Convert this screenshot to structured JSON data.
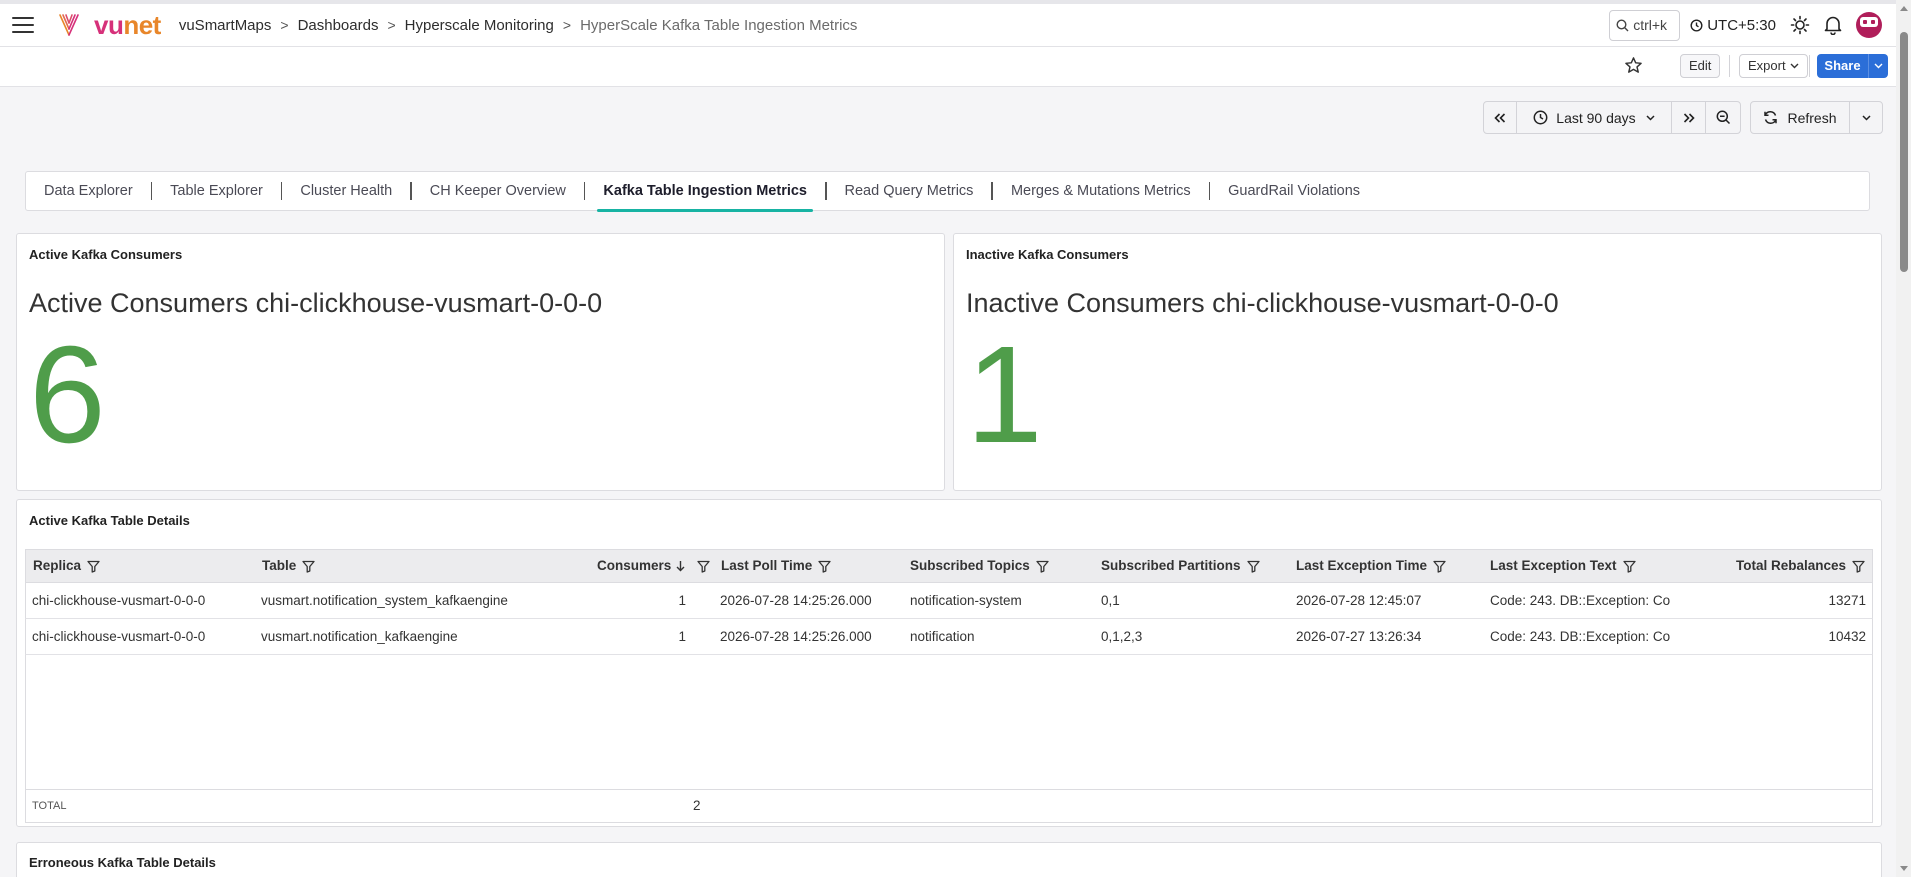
{
  "brand": {
    "logo_vu": "vu",
    "logo_net": "net",
    "colors": {
      "vu": "#d6317a",
      "net": "#e8862a",
      "accent": "#17b3a3",
      "value": "#4f9d4a",
      "primary": "#2b6ed8"
    }
  },
  "breadcrumb": [
    "vuSmartMaps",
    "Dashboards",
    "Hyperscale Monitoring",
    "HyperScale Kafka Table Ingestion Metrics"
  ],
  "header": {
    "search_shortcut": "ctrl+k",
    "timezone": "UTC+5:30"
  },
  "actions": {
    "edit": "Edit",
    "export": "Export",
    "share": "Share"
  },
  "time": {
    "range": "Last 90 days",
    "refresh": "Refresh"
  },
  "tabs": [
    {
      "label": "Data Explorer"
    },
    {
      "label": "Table Explorer"
    },
    {
      "label": "Cluster Health"
    },
    {
      "label": "CH Keeper Overview"
    },
    {
      "label": "Kafka Table Ingestion Metrics",
      "active": true
    },
    {
      "label": "Read Query Metrics"
    },
    {
      "label": "Merges & Mutations Metrics"
    },
    {
      "label": "GuardRail Violations"
    }
  ],
  "active_panel": {
    "title": "Active Kafka Consumers",
    "label": "Active Consumers chi-clickhouse-vusmart-0-0-0",
    "value": "6"
  },
  "inactive_panel": {
    "title": "Inactive Kafka Consumers",
    "label": "Inactive Consumers chi-clickhouse-vusmart-0-0-0",
    "value": "1"
  },
  "table_panel": {
    "title": "Active Kafka Table Details",
    "columns": [
      "Replica",
      "Table",
      "Consumers",
      "Last Poll Time",
      "Subscribed Topics",
      "Subscribed Partitions",
      "Last Exception Time",
      "Last Exception Text",
      "Total Rebalances"
    ],
    "sort_column": "Consumers",
    "sort_direction": "desc",
    "rows": [
      [
        "chi-clickhouse-vusmart-0-0-0",
        "vusmart.notification_system_kafkaengine",
        "1",
        "2026-07-28 14:25:26.000",
        "notification-system",
        "0,1",
        "2026-07-28 12:45:07",
        "Code: 243. DB::Exception: Co",
        "13271"
      ],
      [
        "chi-clickhouse-vusmart-0-0-0",
        "vusmart.notification_kafkaengine",
        "1",
        "2026-07-28 14:25:26.000",
        "notification",
        "0,1,2,3",
        "2026-07-27 13:26:34",
        "Code: 243. DB::Exception: Co",
        "10432"
      ]
    ],
    "footer": {
      "label": "TOTAL",
      "consumers_total": "2"
    }
  },
  "erroneous_panel": {
    "title": "Erroneous Kafka Table Details"
  }
}
